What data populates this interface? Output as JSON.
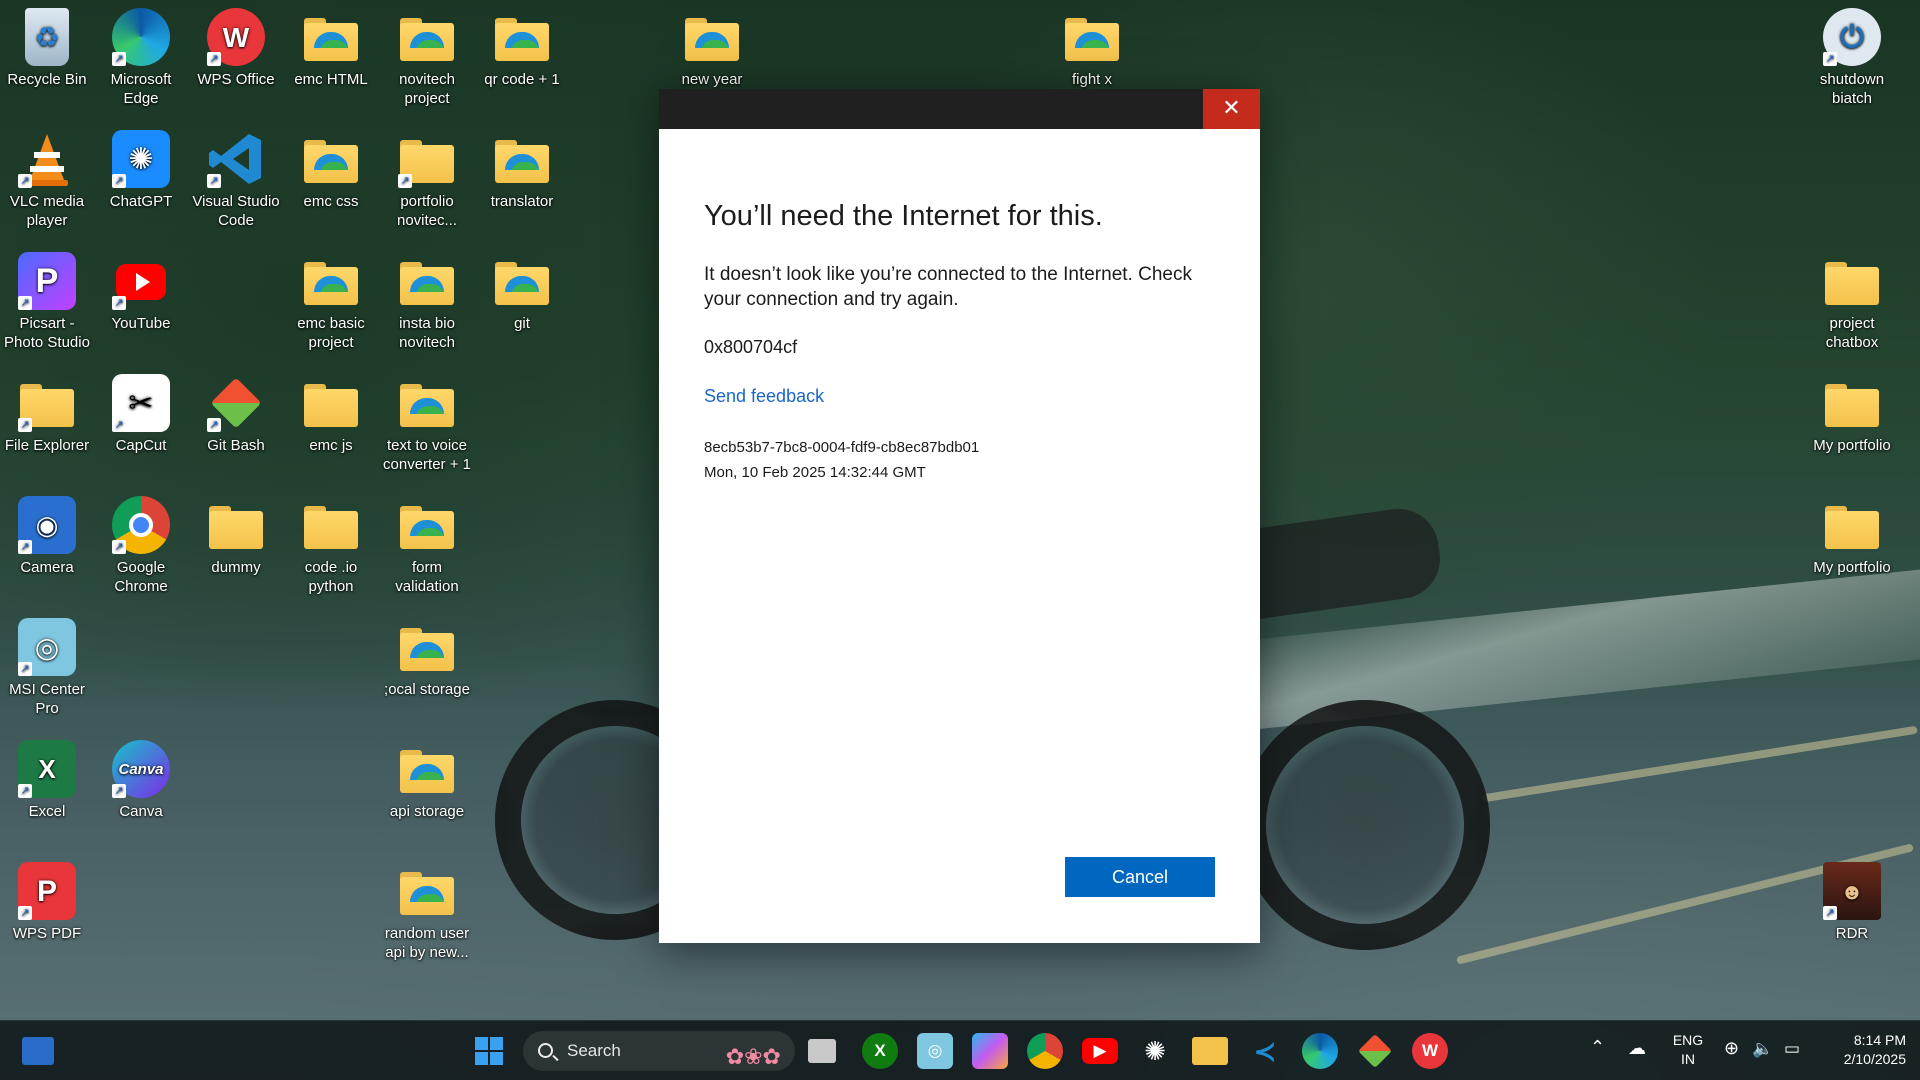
{
  "desktop": {
    "left_icons": [
      {
        "label": "Recycle Bin",
        "icon": "recycle-bin-icon"
      },
      {
        "label": "Microsoft Edge",
        "icon": "edge-icon"
      },
      {
        "label": "WPS Office",
        "icon": "wps-office-icon"
      },
      {
        "label": "emc HTML",
        "icon": "folder-icon"
      },
      {
        "label": "novitech project",
        "icon": "folder-icon"
      },
      {
        "label": "qr code + 1",
        "icon": "folder-icon"
      },
      {
        "label": "VLC media player",
        "icon": "vlc-icon"
      },
      {
        "label": "ChatGPT",
        "icon": "chatgpt-icon"
      },
      {
        "label": "Visual Studio Code",
        "icon": "vscode-icon"
      },
      {
        "label": "emc css",
        "icon": "folder-icon"
      },
      {
        "label": "portfolio novitec...",
        "icon": "folder-icon"
      },
      {
        "label": "translator",
        "icon": "folder-icon"
      },
      {
        "label": "Picsart - Photo Studio",
        "icon": "picsart-icon"
      },
      {
        "label": "YouTube",
        "icon": "youtube-icon"
      },
      {
        "label": "emc basic project",
        "icon": "folder-icon"
      },
      {
        "label": "insta bio novitech",
        "icon": "folder-icon"
      },
      {
        "label": "git",
        "icon": "folder-icon"
      },
      {
        "label": "File Explorer",
        "icon": "file-explorer-icon"
      },
      {
        "label": "CapCut",
        "icon": "capcut-icon"
      },
      {
        "label": "Git Bash",
        "icon": "git-bash-icon"
      },
      {
        "label": "emc js",
        "icon": "folder-icon"
      },
      {
        "label": "text to voice converter + 1",
        "icon": "folder-icon"
      },
      {
        "label": "Camera",
        "icon": "camera-icon"
      },
      {
        "label": "Google Chrome",
        "icon": "chrome-icon"
      },
      {
        "label": "dummy",
        "icon": "folder-icon"
      },
      {
        "label": "code .io python",
        "icon": "folder-icon"
      },
      {
        "label": "form validation",
        "icon": "folder-icon"
      },
      {
        "label": "MSI Center Pro",
        "icon": "msi-center-icon"
      },
      {
        "label": ";ocal storage",
        "icon": "folder-icon"
      },
      {
        "label": "Excel",
        "icon": "excel-icon"
      },
      {
        "label": "Canva",
        "icon": "canva-icon"
      },
      {
        "label": "api storage",
        "icon": "folder-icon"
      },
      {
        "label": "WPS PDF",
        "icon": "wps-pdf-icon"
      },
      {
        "label": "random user api by new...",
        "icon": "folder-icon"
      },
      {
        "label": "new year",
        "icon": "folder-icon"
      },
      {
        "label": "fight x",
        "icon": "folder-icon"
      }
    ],
    "right_icons": [
      {
        "label": "shutdown biatch",
        "icon": "power-icon"
      },
      {
        "label": "project chatbox",
        "icon": "folder-icon"
      },
      {
        "label": "My portfolio",
        "icon": "folder-icon"
      },
      {
        "label": "My portfolio",
        "icon": "folder-icon"
      },
      {
        "label": "RDR",
        "icon": "rdr-icon"
      }
    ]
  },
  "dialog": {
    "close_glyph": "✕",
    "heading": "You’ll need the Internet for this.",
    "message": "It doesn’t look like you’re connected to the Internet. Check your connection and try again.",
    "error_code": "0x800704cf",
    "feedback_link": "Send feedback",
    "correlation_id": "8ecb53b7-7bc8-0004-fdf9-cb8ec87bdb01",
    "timestamp": "Mon, 10 Feb 2025 14:32:44 GMT",
    "cancel_label": "Cancel"
  },
  "taskbar": {
    "search_label": "Search",
    "tray": {
      "language": "ENG",
      "region": "IN",
      "time": "8:14 PM",
      "date": "2/10/2025"
    }
  },
  "colors": {
    "dialog_close_bg": "#c42b1c",
    "button_bg": "#0067c0",
    "link": "#1a67c8"
  }
}
